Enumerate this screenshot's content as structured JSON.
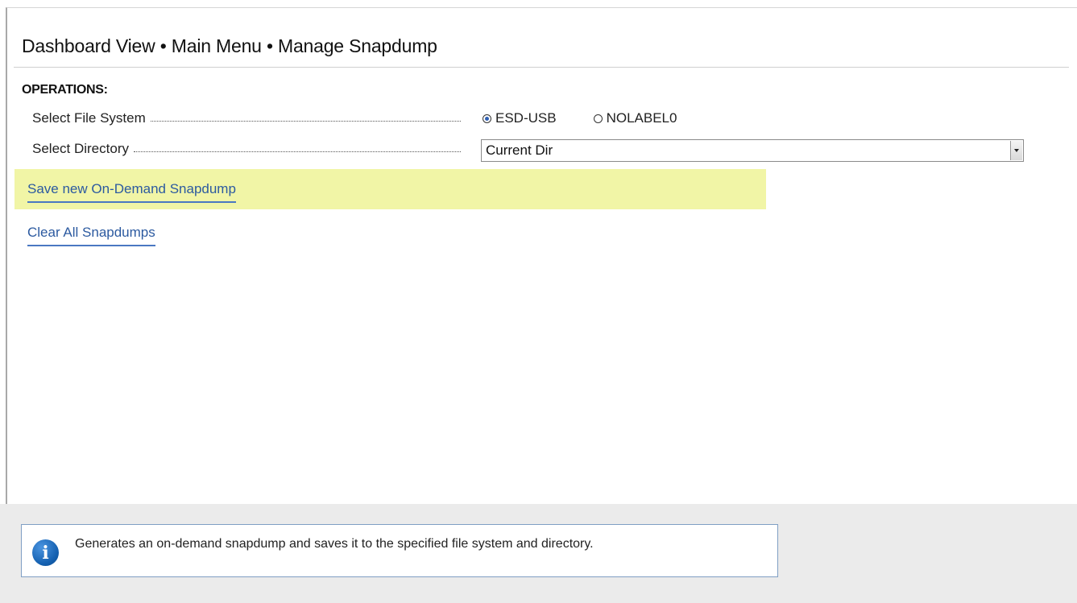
{
  "header": {
    "breadcrumb": "Dashboard View • Main Menu • Manage Snapdump"
  },
  "operations": {
    "section_title": "OPERATIONS:",
    "file_system": {
      "label": "Select File System",
      "options": [
        {
          "label": "ESD-USB",
          "selected": true
        },
        {
          "label": "NOLABEL0",
          "selected": false
        }
      ]
    },
    "directory": {
      "label": "Select Directory",
      "selected_value": "Current Dir"
    },
    "actions": [
      {
        "label": "Save new On-Demand Snapdump",
        "highlighted": true
      },
      {
        "label": "Clear All Snapdumps",
        "highlighted": false
      }
    ]
  },
  "help": {
    "icon": "info-icon",
    "text": "Generates an on-demand snapdump and saves it to the specified file system and directory."
  },
  "colors": {
    "link": "#2c5aa0",
    "highlight": "#f1f5a6",
    "radio_selected": "#2f5fb3",
    "info_icon": "#1460b0",
    "footer_bg": "#ebebeb"
  }
}
